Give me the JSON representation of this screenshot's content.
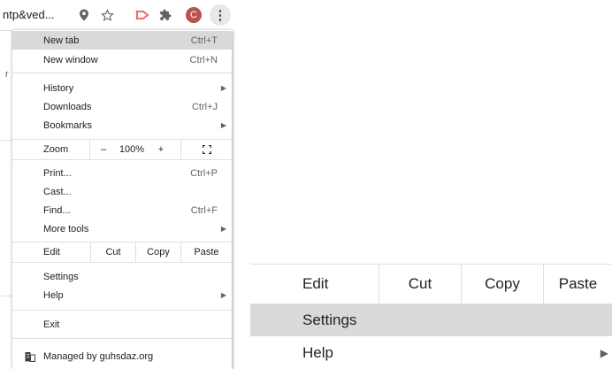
{
  "toolbar": {
    "url_fragment": "ntp&ved...",
    "icons": [
      "location-pin-icon",
      "star-icon",
      "extension-arrow-icon",
      "puzzle-icon"
    ],
    "avatar_letter": "C",
    "avatar_color": "#b4544a",
    "menu_icon": "kebab-icon"
  },
  "page": {
    "left_fragment": "r"
  },
  "menu": {
    "new_tab": {
      "label": "New tab",
      "shortcut": "Ctrl+T"
    },
    "new_window": {
      "label": "New window",
      "shortcut": "Ctrl+N"
    },
    "history": {
      "label": "History"
    },
    "downloads": {
      "label": "Downloads",
      "shortcut": "Ctrl+J"
    },
    "bookmarks": {
      "label": "Bookmarks"
    },
    "zoom": {
      "label": "Zoom",
      "minus": "–",
      "value": "100%",
      "plus": "+",
      "fullscreen_icon": "fullscreen-icon"
    },
    "print": {
      "label": "Print...",
      "shortcut": "Ctrl+P"
    },
    "cast": {
      "label": "Cast..."
    },
    "find": {
      "label": "Find...",
      "shortcut": "Ctrl+F"
    },
    "more_tools": {
      "label": "More tools"
    },
    "edit": {
      "label": "Edit",
      "cut": "Cut",
      "copy": "Copy",
      "paste": "Paste"
    },
    "settings": {
      "label": "Settings"
    },
    "help": {
      "label": "Help"
    },
    "exit": {
      "label": "Exit"
    },
    "managed": {
      "label": "Managed by guhsdaz.org",
      "icon": "building-icon"
    },
    "submenu_arrow": "▶",
    "highlight_color": "#d9d9d9"
  },
  "zoomed_detail": {
    "edit": "Edit",
    "cut": "Cut",
    "copy": "Copy",
    "paste": "Paste",
    "settings": "Settings",
    "help": "Help"
  }
}
